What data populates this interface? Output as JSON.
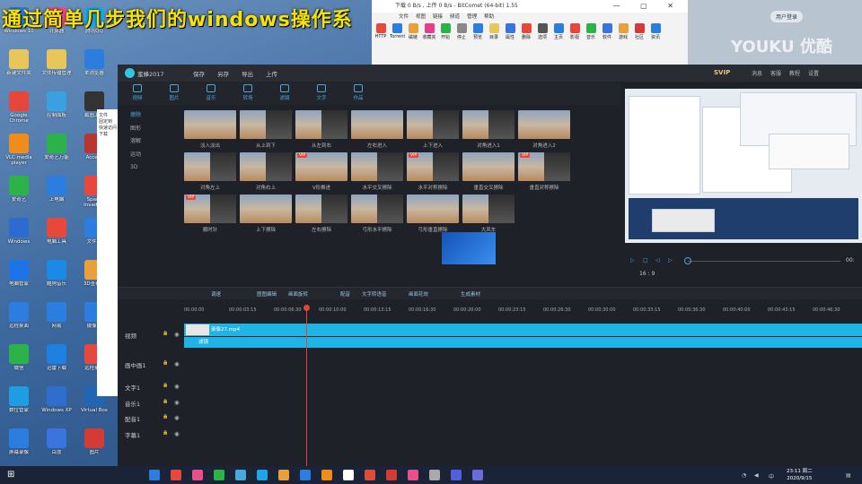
{
  "caption": "通过简单几步我们的windows操作系",
  "desktop": {
    "icons": [
      {
        "label": "Windows 10 ",
        "color": "#2b7ee0"
      },
      {
        "label": "新建文件夹",
        "color": "#e8c65a"
      },
      {
        "label": "Google Chrome",
        "color": "#e6473b"
      },
      {
        "label": "VLC media player",
        "color": "#f08c1a"
      },
      {
        "label": "爱奇艺",
        "color": "#2bb34a"
      },
      {
        "label": "Windows",
        "color": "#2d6bd1"
      },
      {
        "label": "电脑管家",
        "color": "#1d73e8"
      },
      {
        "label": "远程桌面",
        "color": "#2b7ee0"
      },
      {
        "label": "微信",
        "color": "#2bb34a"
      },
      {
        "label": "数位管家",
        "color": "#1f9de3"
      },
      {
        "label": "屏幕录像",
        "color": "#2b7ee0"
      },
      {
        "label": "计算器",
        "color": "#ea4d8b"
      },
      {
        "label": "文件传输管理",
        "color": "#e8c65a"
      },
      {
        "label": "控制面板",
        "color": "#3aa0df"
      },
      {
        "label": "爱奇艺万能",
        "color": "#2bb34a"
      },
      {
        "label": "上电脑",
        "color": "#2b7ee0"
      },
      {
        "label": "电脑工具",
        "color": "#e8483c"
      },
      {
        "label": "酷狗音乐",
        "color": "#1a8ae6"
      },
      {
        "label": "网易",
        "color": "#2b7ee0"
      },
      {
        "label": "迅雷下载",
        "color": "#1e80e0"
      },
      {
        "label": "Windows XP",
        "color": "#2f6ecf"
      },
      {
        "label": "百度",
        "color": "#3a74df"
      },
      {
        "label": "腾讯QQ",
        "color": "#1ca5e8"
      },
      {
        "label": "IE浏览器",
        "color": "#2b7ee0"
      },
      {
        "label": "截图工具",
        "color": "#333333"
      },
      {
        "label": "Access",
        "color": "#b9352f"
      },
      {
        "label": "Space Invaders",
        "color": "#e8483c"
      },
      {
        "label": "文件夹",
        "color": "#2b7ee0"
      },
      {
        "label": "3D查看器",
        "color": "#e8a13a"
      },
      {
        "label": "摄像头",
        "color": "#2b7ee0"
      },
      {
        "label": "远程桌面",
        "color": "#e8483c"
      },
      {
        "label": "Virtual Box",
        "color": "#2166b5"
      },
      {
        "label": "图片",
        "color": "#d33b34"
      }
    ]
  },
  "bitcomet": {
    "title": "下载 0 B/s , 上传 0 B/s - BitComet (64-bit) 1.55",
    "menu": [
      "文件",
      "视图",
      "链接",
      "频道",
      "管理",
      "帮助"
    ],
    "tools": [
      {
        "label": "HTTP",
        "color": "#e8483c"
      },
      {
        "label": "Torrent",
        "color": "#2b7ee0"
      },
      {
        "label": "磁链",
        "color": "#e8a13a"
      },
      {
        "label": "收藏夹",
        "color": "#e83d8b"
      },
      {
        "label": "开始",
        "color": "#2bb34a"
      },
      {
        "label": "停止",
        "color": "#888888"
      },
      {
        "label": "预览",
        "color": "#2b7ee0"
      },
      {
        "label": "目录",
        "color": "#e8c65a"
      },
      {
        "label": "属性",
        "color": "#3a74df"
      },
      {
        "label": "删除",
        "color": "#e8483c"
      },
      {
        "label": "选项",
        "color": "#555555"
      },
      {
        "label": "主页",
        "color": "#2b7ee0"
      },
      {
        "label": "影视",
        "color": "#e8483c"
      },
      {
        "label": "音乐",
        "color": "#2bb34a"
      },
      {
        "label": "软件",
        "color": "#3a74df"
      },
      {
        "label": "游戏",
        "color": "#e8a13a"
      },
      {
        "label": "社区",
        "color": "#d33b34"
      },
      {
        "label": "资讯",
        "color": "#2b7ee0"
      }
    ]
  },
  "youku": {
    "logo": "YOUKU 优酷",
    "badge": "用户登录"
  },
  "editor": {
    "project_name": "蜜蜂2017",
    "menu": [
      "保存",
      "另存",
      "导出",
      "上传"
    ],
    "svip": "SVIP",
    "right_menu": [
      "消息",
      "客服",
      "教程",
      "设置"
    ],
    "tabs": [
      "视频",
      "图片",
      "音乐",
      "转场",
      "滤镜",
      "文字",
      "作品"
    ],
    "categories": [
      "擦除",
      "图形",
      "溶解",
      "运动",
      "3D"
    ],
    "transitions": [
      {
        "name": "淡入淡出",
        "vip": false
      },
      {
        "name": "从上到下",
        "vip": false
      },
      {
        "name": "从左到右",
        "vip": false
      },
      {
        "name": "左右进入",
        "vip": false
      },
      {
        "name": "上下进入",
        "vip": false
      },
      {
        "name": "对角进入1",
        "vip": false
      },
      {
        "name": "对角进入2",
        "vip": false
      },
      {
        "name": "对角左上",
        "vip": false
      },
      {
        "name": "对角右上",
        "vip": false
      },
      {
        "name": "V形推进",
        "vip": true
      },
      {
        "name": "水平交叉擦除",
        "vip": false
      },
      {
        "name": "水平对称擦除",
        "vip": true
      },
      {
        "name": "垂直交叉擦除",
        "vip": false
      },
      {
        "name": "垂直对称擦除",
        "vip": true
      },
      {
        "name": "顺时针",
        "vip": true
      },
      {
        "name": "上下擦除",
        "vip": false
      },
      {
        "name": "左右擦除",
        "vip": false
      },
      {
        "name": "弓形水平擦除",
        "vip": false
      },
      {
        "name": "弓形垂直擦除",
        "vip": false
      },
      {
        "name": "大风车",
        "vip": false
      }
    ],
    "preview": {
      "ratio": "16 : 9",
      "time": "00:"
    },
    "timeline_tools": [
      "调速",
      "图图编辑",
      "画面旋转",
      "配音",
      "文字转语音",
      "画面花效",
      "生成素材"
    ],
    "ruler": [
      "00:00:00",
      "00:00:03:15",
      "00:00:06:30",
      "00:00:10:00",
      "00:00:13:15",
      "00:00:16:30",
      "00:00:20:00",
      "00:00:23:15",
      "00:00:26:30",
      "00:00:30:00",
      "00:00:33:15",
      "00:00:36:30",
      "00:00:40:00",
      "00:00:43:15",
      "00:00:46:30"
    ],
    "tracks": [
      "视频",
      "画中画1",
      "文字1",
      "音乐1",
      "配音1",
      "字幕1"
    ],
    "clips": {
      "video": "录像27.mp4",
      "filter": "滤镜"
    }
  },
  "sidebar_snippet": [
    "文件",
    "固定到",
    "快速访问",
    "下载"
  ],
  "taskbar": {
    "time": "23:11 周二",
    "date": "2020/9/15",
    "icons": [
      "#2b7ee0",
      "#e8483c",
      "#ea4d8b",
      "#2bb34a",
      "#4aa8d8",
      "#1ca5e8",
      "#e8a13a",
      "#2b7ee0",
      "#f08c1a",
      "#ffffff",
      "#dd4b39",
      "#d33b34",
      "#ea4d8b",
      "#aaaaaa",
      "#5060e0",
      "#6b6bd8"
    ]
  }
}
